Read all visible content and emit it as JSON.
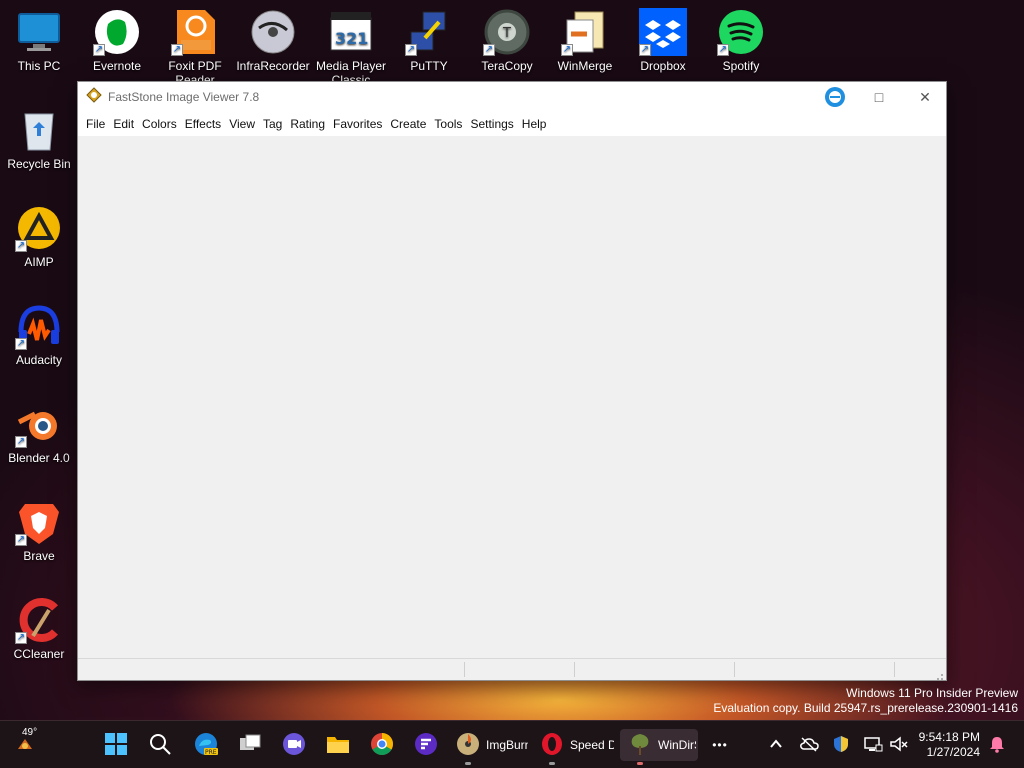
{
  "desktop": {
    "top_row": [
      {
        "label": "This PC",
        "icon": "monitor-icon"
      },
      {
        "label": "Evernote",
        "icon": "evernote-icon"
      },
      {
        "label": "Foxit PDF Reader",
        "icon": "foxit-pdf-icon"
      },
      {
        "label": "InfraRecorder",
        "icon": "infrarecorder-icon"
      },
      {
        "label": "Media Player Classic",
        "icon": "mpc-icon"
      },
      {
        "label": "PuTTY",
        "icon": "putty-icon"
      },
      {
        "label": "TeraCopy",
        "icon": "teracopy-icon"
      },
      {
        "label": "WinMerge",
        "icon": "winmerge-icon"
      },
      {
        "label": "Dropbox",
        "icon": "dropbox-icon"
      },
      {
        "label": "Spotify",
        "icon": "spotify-icon"
      }
    ],
    "left_column": [
      {
        "label": "Recycle Bin",
        "icon": "recycle-bin-icon"
      },
      {
        "label": "AIMP",
        "icon": "aimp-icon"
      },
      {
        "label": "Audacity",
        "icon": "audacity-icon"
      },
      {
        "label": "Blender 4.0",
        "icon": "blender-icon"
      },
      {
        "label": "Brave",
        "icon": "brave-icon"
      },
      {
        "label": "CCleaner",
        "icon": "ccleaner-icon"
      }
    ]
  },
  "window": {
    "title": "FastStone Image Viewer 7.8",
    "menu": [
      "File",
      "Edit",
      "Colors",
      "Effects",
      "View",
      "Tag",
      "Rating",
      "Favorites",
      "Create",
      "Tools",
      "Settings",
      "Help"
    ],
    "controls": {
      "minimize": "−",
      "maximize": "□",
      "close": "✕"
    }
  },
  "watermark": {
    "line1": "Windows 11 Pro Insider Preview",
    "line2": "Evaluation copy. Build 25947.rs_prerelease.230901-1416"
  },
  "taskbar": {
    "weather": "49°",
    "apps": [
      {
        "name": "start",
        "icon": "windows-start-icon"
      },
      {
        "name": "search",
        "icon": "search-icon"
      },
      {
        "name": "edge",
        "icon": "edge-pre-icon"
      },
      {
        "name": "task-view",
        "icon": "task-view-icon"
      },
      {
        "name": "meet",
        "icon": "video-call-icon"
      },
      {
        "name": "explorer",
        "icon": "folder-icon"
      },
      {
        "name": "chrome",
        "icon": "chrome-icon"
      },
      {
        "name": "app",
        "icon": "purple-app-icon"
      }
    ],
    "labeled_apps": [
      {
        "label": "ImgBurn",
        "icon": "imgburn-icon"
      },
      {
        "label": "Speed Dial",
        "icon": "opera-icon"
      },
      {
        "label": "WinDirStat",
        "icon": "windirstat-icon"
      }
    ],
    "more": "•••",
    "time": "9:54:18 PM",
    "date": "1/27/2024"
  },
  "colors": {
    "accent": "#1f6fd0",
    "window_bg": "#f0f0f0",
    "taskbar_bg": "#1d1418"
  }
}
